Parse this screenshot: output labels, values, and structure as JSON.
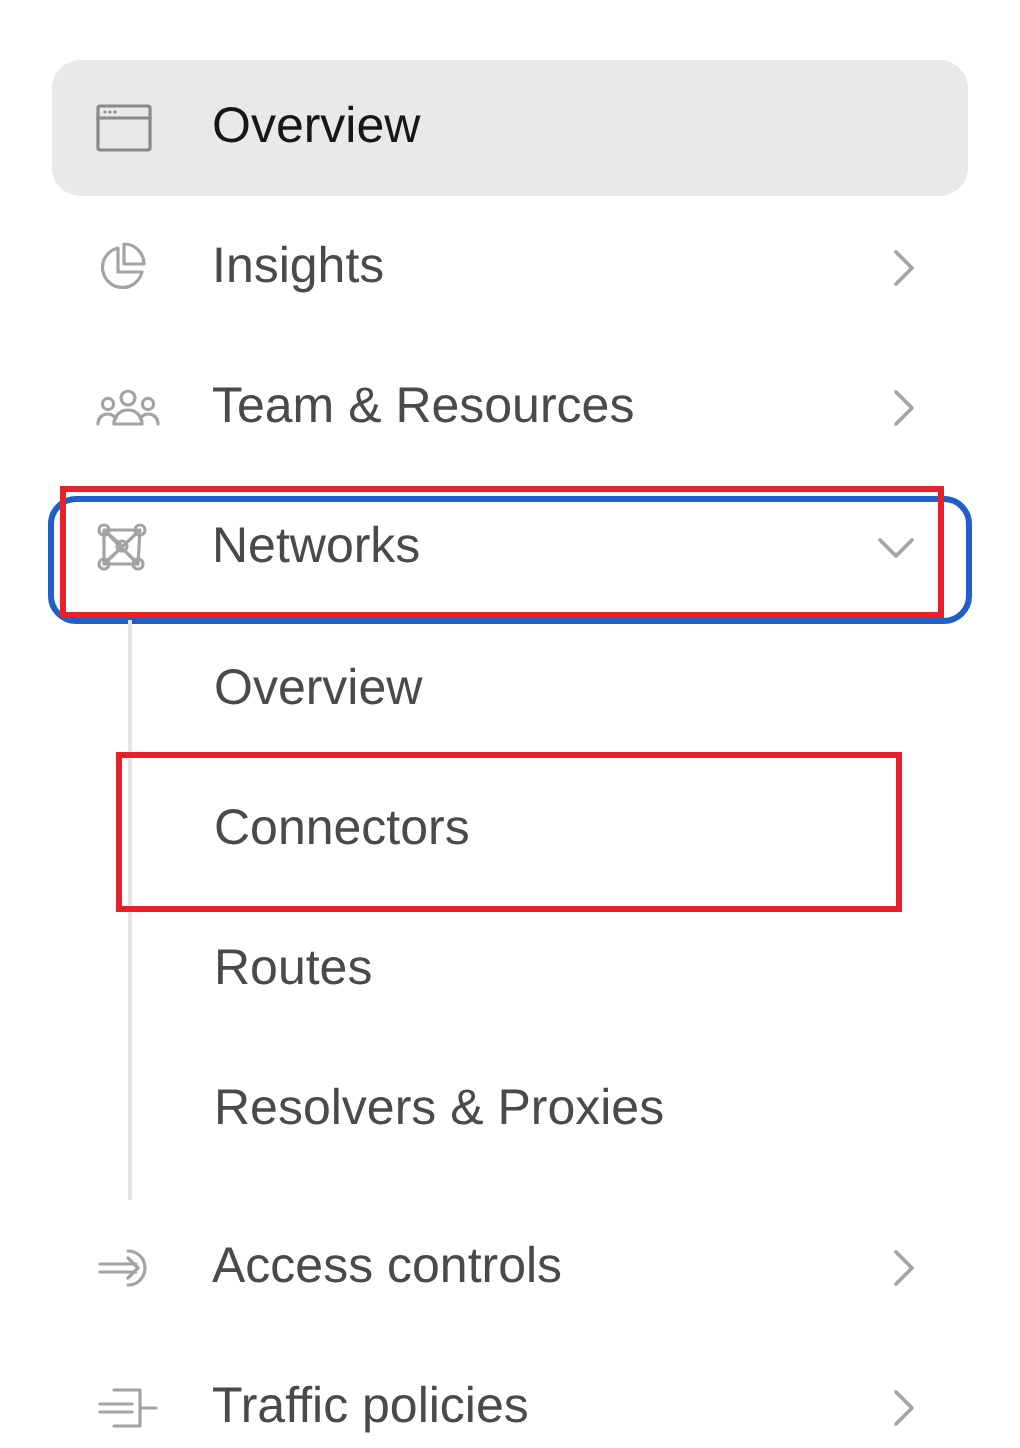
{
  "nav": [
    {
      "label": "Overview",
      "kind": "window",
      "selected": true,
      "highlighted": false
    },
    {
      "label": "Insights",
      "kind": "pie",
      "selected": false,
      "expanded": false,
      "highlighted": false
    },
    {
      "label": "Team & Resources",
      "kind": "people",
      "selected": false,
      "expanded": false,
      "highlighted": false
    },
    {
      "label": "Networks",
      "kind": "network",
      "selected": false,
      "expanded": true,
      "focused": true,
      "highlighted": true,
      "children": [
        {
          "label": "Overview",
          "selected": false,
          "highlighted": false
        },
        {
          "label": "Connectors",
          "selected": false,
          "highlighted": true
        },
        {
          "label": "Routes",
          "selected": false,
          "highlighted": false
        },
        {
          "label": "Resolvers & Proxies",
          "selected": false,
          "highlighted": false
        }
      ]
    },
    {
      "label": "Access controls",
      "kind": "enter",
      "selected": false,
      "expanded": false,
      "highlighted": false
    },
    {
      "label": "Traffic policies",
      "kind": "gate",
      "selected": false,
      "expanded": false,
      "highlighted": false
    }
  ]
}
